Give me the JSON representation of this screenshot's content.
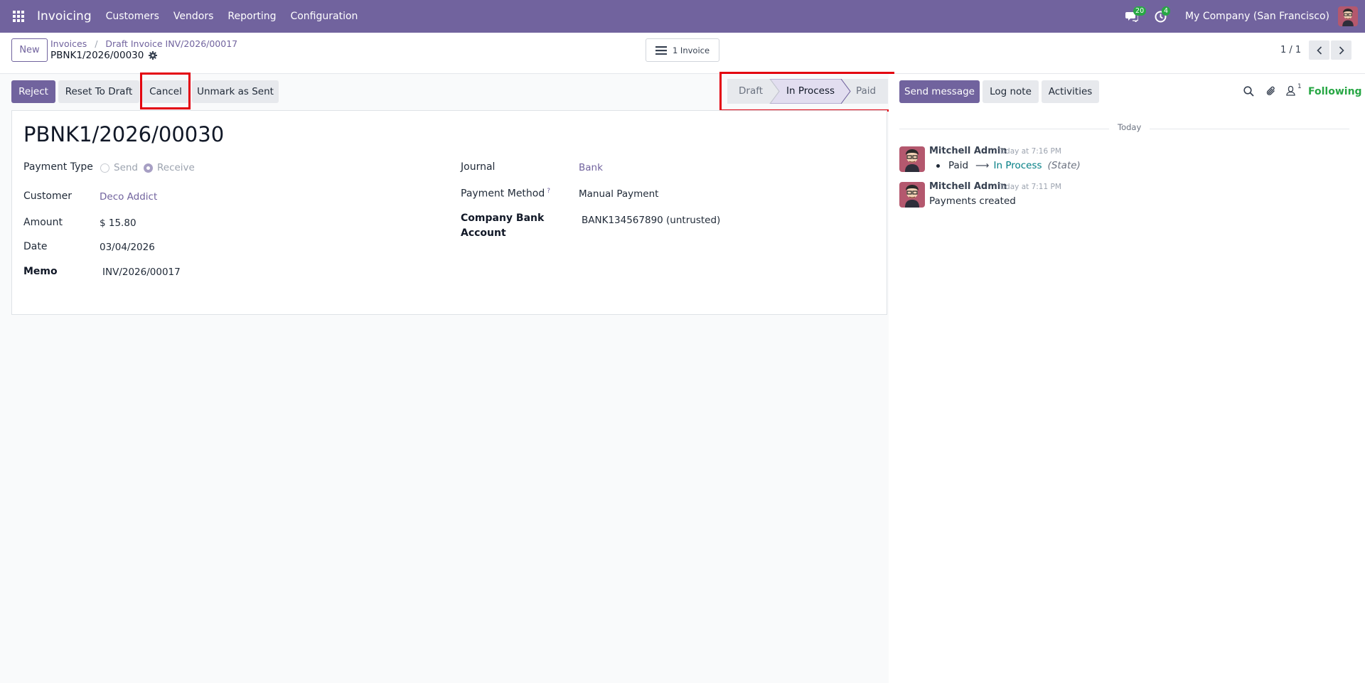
{
  "navbar": {
    "app_name": "Invoicing",
    "menu": [
      "Customers",
      "Vendors",
      "Reporting",
      "Configuration"
    ],
    "messages_count": "20",
    "activities_count": "4",
    "company": "My Company (San Francisco)"
  },
  "control": {
    "new_label": "New",
    "breadcrumbs": [
      "Invoices",
      "Draft Invoice INV/2026/00017"
    ],
    "current": "PBNK1/2026/00030",
    "smart_button": "1 Invoice",
    "pager": "1 / 1"
  },
  "actions": {
    "reject": "Reject",
    "reset_to_draft": "Reset To Draft",
    "cancel": "Cancel",
    "unmark_sent": "Unmark as Sent"
  },
  "status": {
    "steps": [
      "Draft",
      "In Process",
      "Paid"
    ],
    "active": "In Process"
  },
  "record": {
    "title": "PBNK1/2026/00030",
    "payment_type_label": "Payment Type",
    "payment_type_options": [
      "Send",
      "Receive"
    ],
    "payment_type_selected": "Receive",
    "customer_label": "Customer",
    "customer": "Deco Addict",
    "amount_label": "Amount",
    "amount": "$ 15.80",
    "date_label": "Date",
    "date": "03/04/2026",
    "memo_label": "Memo",
    "memo": "INV/2026/00017",
    "journal_label": "Journal",
    "journal": "Bank",
    "payment_method_label": "Payment Method",
    "payment_method_help": "?",
    "payment_method": "Manual Payment",
    "bank_account_label_1": "Company Bank",
    "bank_account_label_2": "Account",
    "bank_account": "BANK134567890 (untrusted)"
  },
  "chatter": {
    "send_message": "Send message",
    "log_note": "Log note",
    "activities": "Activities",
    "followers_count": "1",
    "following": "Following",
    "date_separator": "Today",
    "messages": [
      {
        "author": "Mitchell Admin",
        "time": "Today at 7:16 PM",
        "tracking": {
          "old": "Paid",
          "new": "In Process",
          "field": "(State)"
        }
      },
      {
        "author": "Mitchell Admin",
        "time": "Today at 7:11 PM",
        "body": "Payments created"
      }
    ]
  },
  "colors": {
    "brand": "#71639e",
    "highlight": "#e3000f",
    "success": "#28a745",
    "tracking_value": "#017e84"
  },
  "icons": [
    "apps-grid-icon",
    "chat-icon",
    "clock-icon",
    "gear-icon",
    "list-icon",
    "chevron-left-icon",
    "chevron-right-icon",
    "search-icon",
    "paperclip-icon",
    "user-icon"
  ]
}
